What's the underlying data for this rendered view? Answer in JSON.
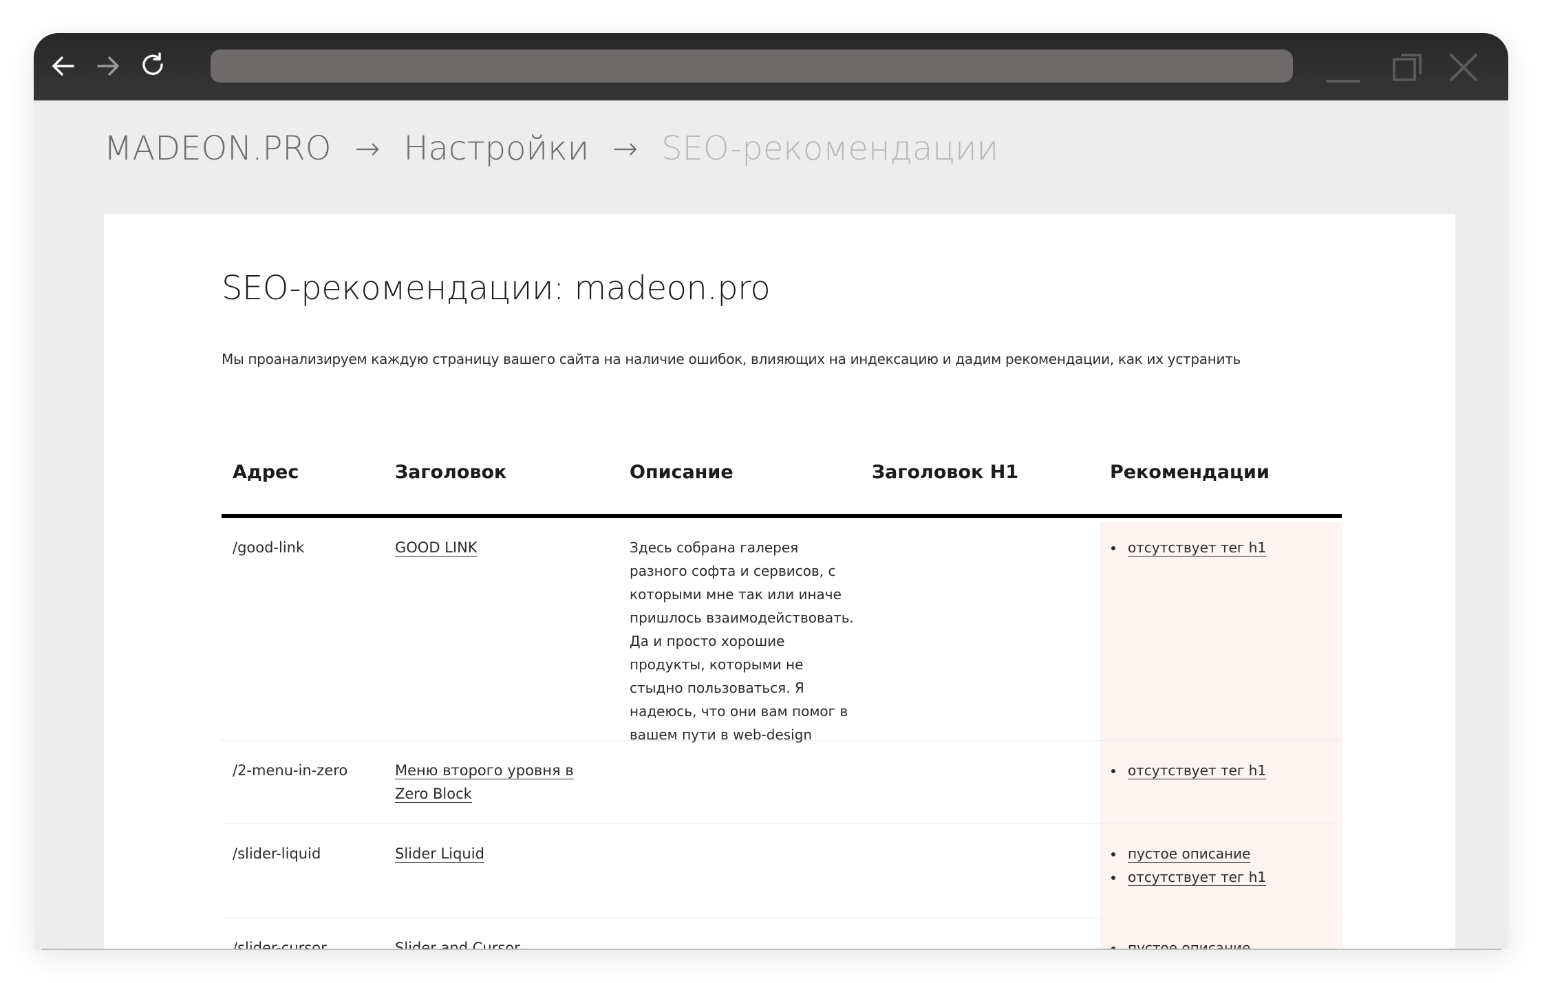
{
  "browser": {
    "url": ""
  },
  "breadcrumb": {
    "items": [
      "MADEON.PRO",
      "Настройки",
      "SEO-рекомендации"
    ],
    "separator": "→"
  },
  "page": {
    "title": "SEO-рекомендации: madeon.pro",
    "description": "Мы проанализируем каждую страницу вашего сайта на наличие ошибок, влияющих на индексацию и дадим рекомендации, как их устранить"
  },
  "table": {
    "columns": [
      "Адрес",
      "Заголовок",
      "Описание",
      "Заголовок H1",
      "Рекомендации"
    ],
    "rows": [
      {
        "address": "/good-link",
        "title": "GOOD LINK",
        "description": "Здесь собрана галерея разного софта и сервисов, с которыми мне так или иначе пришлось взаимодействовать. Да и просто хорошие продукты, которыми не стыдно пользоваться. Я надеюсь, что они вам помог в вашем пути в web-design",
        "h1": "",
        "recommendations": [
          "отсутствует тег h1"
        ]
      },
      {
        "address": "/2-menu-in-zero",
        "title": "Меню второго уровня в Zero Block",
        "description": "",
        "h1": "",
        "recommendations": [
          "отсутствует тег h1"
        ]
      },
      {
        "address": "/slider-liquid",
        "title": "Slider Liquid",
        "description": "",
        "h1": "",
        "recommendations": [
          "пустое описание",
          "отсутствует тег h1"
        ]
      },
      {
        "address": "/slider-cursor",
        "title": "Slider and Cursor",
        "description": "",
        "h1": "",
        "recommendations": [
          "пустое описание"
        ]
      }
    ]
  },
  "colors": {
    "browser_bar": "#2e2e2e",
    "page_bg": "#ededed",
    "card_bg": "#ffffff",
    "recommendations_bg": "#fdf3f0"
  }
}
